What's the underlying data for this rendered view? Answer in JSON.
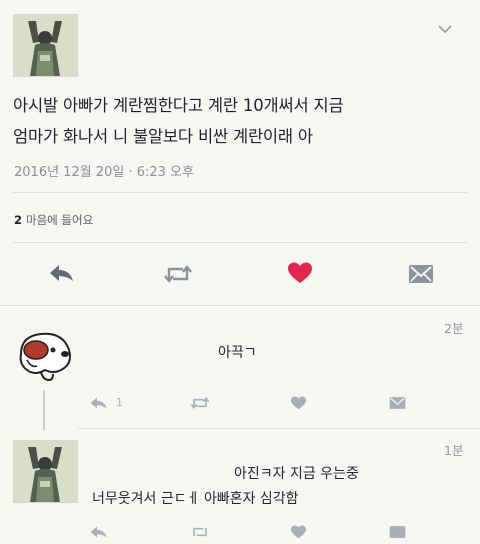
{
  "main_tweet": {
    "text_line1": "아시발 아빠가 계란찜한다고 계란 10개써서 지금",
    "text_line2": "엄마가 화나서 니 불알보다 비싼 계란이래 아",
    "timestamp": "2016년 12월 20일 · 6:23 오후",
    "likes_count": "2",
    "likes_label": "마음에 들어요"
  },
  "replies": [
    {
      "time": "2분",
      "text": "아끅ㄱ",
      "reply_count": "1"
    },
    {
      "time": "1분",
      "text_line1": "아진ㅋ자 지금 우는중",
      "text_line2": "너무웃겨서 근ㄷㅔ 아빠혼자 심각함"
    }
  ],
  "colors": {
    "like_heart": "#e2264d",
    "icon_gray": "#8b949c",
    "background": "#f6f7f3"
  },
  "icons": [
    "reply-icon",
    "retweet-icon",
    "heart-icon",
    "dm-icon",
    "chevron-down-icon"
  ]
}
